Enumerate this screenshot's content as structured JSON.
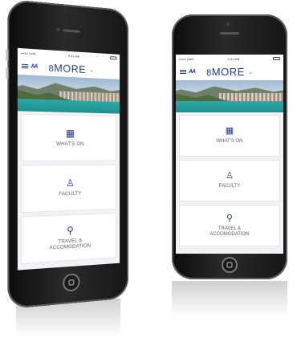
{
  "status_bar": {
    "carrier": "•••oo ⟨wifi⟩",
    "time": "9:41 AM",
    "battery": "100%"
  },
  "header": {
    "logo": "AA",
    "title_number": "8",
    "title_text": "MORE",
    "chevron": "⌄"
  },
  "cards": [
    {
      "icon": "calendar-icon",
      "glyph": "▦",
      "label": "WHAT'S ON"
    },
    {
      "icon": "person-icon",
      "glyph": "♙",
      "label": "FACULTY"
    },
    {
      "icon": "location-pin-icon",
      "glyph": "⚲",
      "label": "TRAVEL &\nACCOMODATION"
    }
  ],
  "colors": {
    "brand_blue": "#233a8c",
    "lake_teal": "#2ea9a4",
    "phone_black": "#111111"
  }
}
